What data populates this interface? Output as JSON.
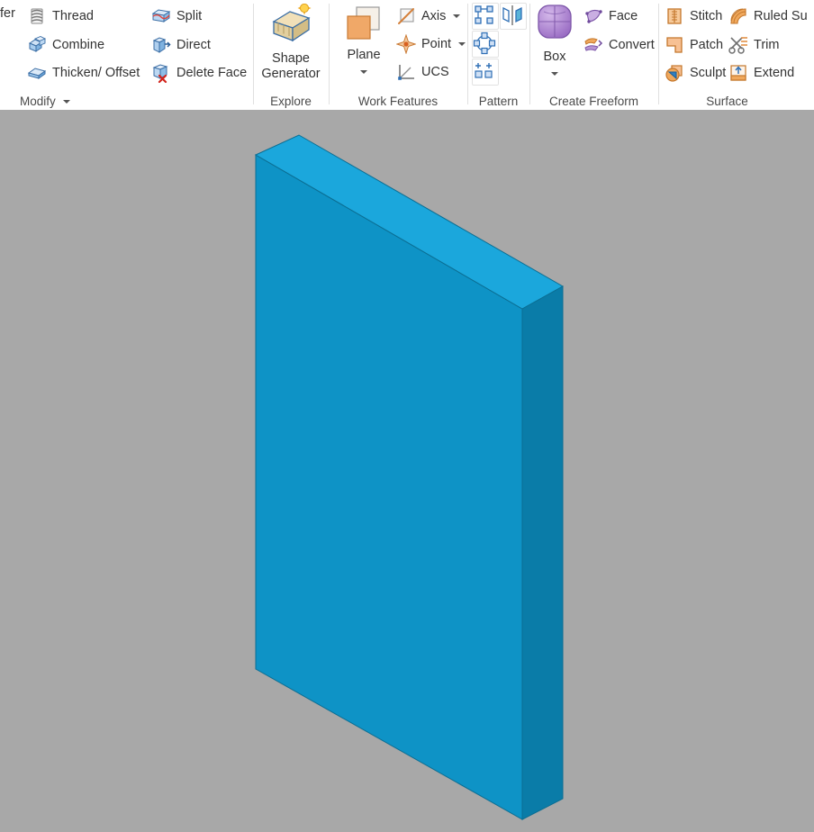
{
  "app": {
    "background_color": "#a8a8a8",
    "ribbon_background": "#ffffff"
  },
  "ribbon": {
    "panels": [
      {
        "id": "modify",
        "title": "Modify",
        "has_dropdown": true,
        "truncated_left_label": "fer",
        "items": [
          {
            "label": "Thread",
            "icon": "thread-icon"
          },
          {
            "label": "Combine",
            "icon": "combine-icon"
          },
          {
            "label": "Thicken/ Offset",
            "icon": "thicken-offset-icon"
          },
          {
            "label": "Split",
            "icon": "split-icon"
          },
          {
            "label": "Direct",
            "icon": "direct-icon"
          },
          {
            "label": "Delete Face",
            "icon": "delete-face-icon"
          }
        ]
      },
      {
        "id": "explore",
        "title": "Explore",
        "items": [
          {
            "label_line1": "Shape",
            "label_line2": "Generator",
            "icon": "shape-generator-icon"
          }
        ]
      },
      {
        "id": "work-features",
        "title": "Work Features",
        "items": [
          {
            "label": "Plane",
            "icon": "plane-icon",
            "has_dropdown": true
          },
          {
            "label": "Axis",
            "icon": "axis-icon",
            "has_dropdown": true
          },
          {
            "label": "Point",
            "icon": "point-icon",
            "has_dropdown": true
          },
          {
            "label": "UCS",
            "icon": "ucs-icon"
          }
        ]
      },
      {
        "id": "pattern",
        "title": "Pattern",
        "items": [
          {
            "label": "",
            "icon": "rectangular-pattern-icon"
          },
          {
            "label": "",
            "icon": "mirror-icon"
          },
          {
            "label": "",
            "icon": "circular-pattern-icon"
          },
          {
            "label": "",
            "icon": "sketch-driven-pattern-icon"
          }
        ]
      },
      {
        "id": "create-freeform",
        "title": "Create Freeform",
        "items": [
          {
            "label": "Box",
            "icon": "freeform-box-icon",
            "has_dropdown": true
          },
          {
            "label": "Face",
            "icon": "freeform-face-icon"
          },
          {
            "label": "Convert",
            "icon": "freeform-convert-icon"
          }
        ]
      },
      {
        "id": "surface",
        "title": "Surface",
        "items": [
          {
            "label": "Stitch",
            "icon": "stitch-icon"
          },
          {
            "label": "Patch",
            "icon": "patch-icon"
          },
          {
            "label": "Sculpt",
            "icon": "sculpt-icon"
          },
          {
            "label": "Ruled Su",
            "icon": "ruled-surface-icon"
          },
          {
            "label": "Trim",
            "icon": "trim-icon"
          },
          {
            "label": "Extend",
            "icon": "extend-icon"
          }
        ]
      }
    ]
  },
  "canvas": {
    "model": {
      "name": "extruded-plate",
      "face_top_color": "#1ba7dc",
      "face_front_color": "#0e93c6",
      "face_side_color": "#0a7ca8",
      "edge_color": "#0b6e93"
    }
  }
}
